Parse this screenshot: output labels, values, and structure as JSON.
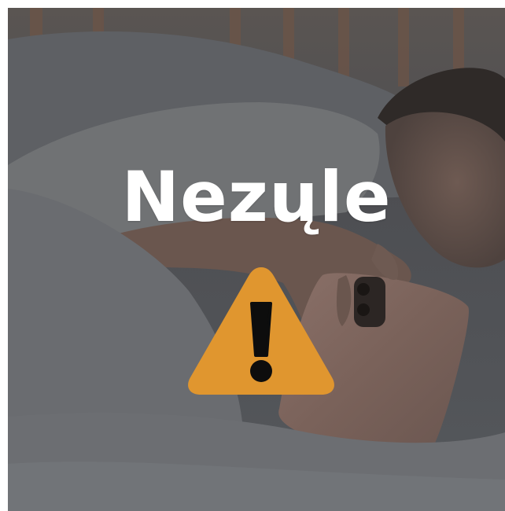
{
  "headline": "Nezųle",
  "icons": {
    "warning": "warning-triangle-icon"
  },
  "colors": {
    "overlay": "#4a4b4d",
    "headline_text": "#ffffff",
    "warning_fill": "#e0962f",
    "warning_mark": "#0d0d0d"
  }
}
